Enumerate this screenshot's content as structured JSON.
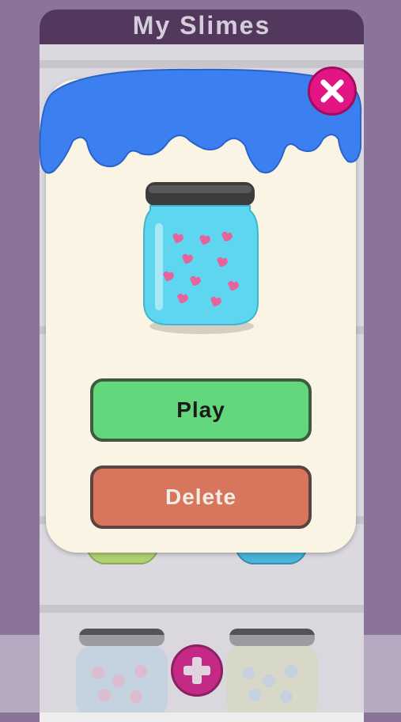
{
  "header": {
    "title": "My Slimes"
  },
  "modal": {
    "play_label": "Play",
    "delete_label": "Delete"
  },
  "icons": {
    "close": "close-icon",
    "add": "plus-icon",
    "jar": "slime-jar-hearts"
  },
  "colors": {
    "header_bg": "#452a4e",
    "slime_blue": "#3b7ff0",
    "play_green": "#63d77c",
    "delete_red": "#d7765d",
    "close_pink": "#e21585",
    "modal_bg": "#faf4e4"
  }
}
